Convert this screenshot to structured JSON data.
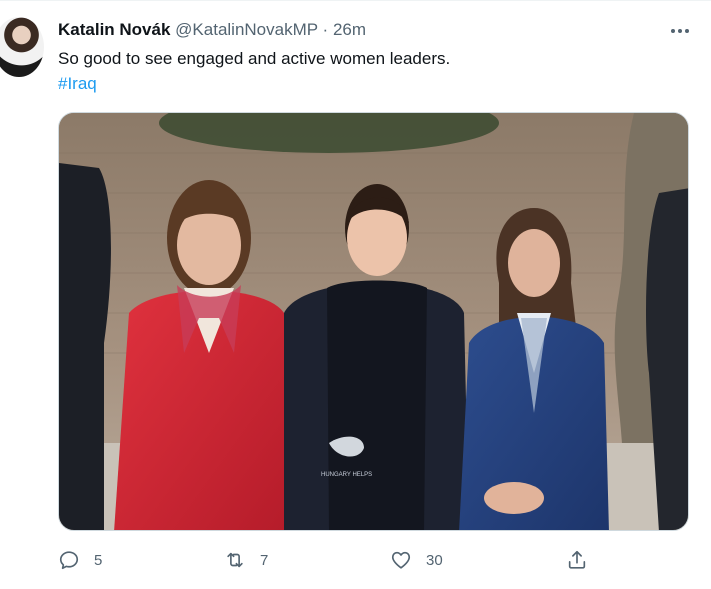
{
  "author": {
    "display_name": "Katalin Novák",
    "handle": "@KatalinNovakMP",
    "separator": "·",
    "time": "26m"
  },
  "tweet": {
    "text": "So good to see engaged and active women leaders.",
    "hashtag": "#Iraq"
  },
  "media": {
    "description_icon": "photo",
    "vest_logo_text": "HUNGARY HELPS"
  },
  "actions": {
    "reply_count": "5",
    "retweet_count": "7",
    "like_count": "30"
  },
  "colors": {
    "link": "#1d9bf0",
    "secondary_text": "#536471",
    "primary_text": "#0f1419"
  }
}
